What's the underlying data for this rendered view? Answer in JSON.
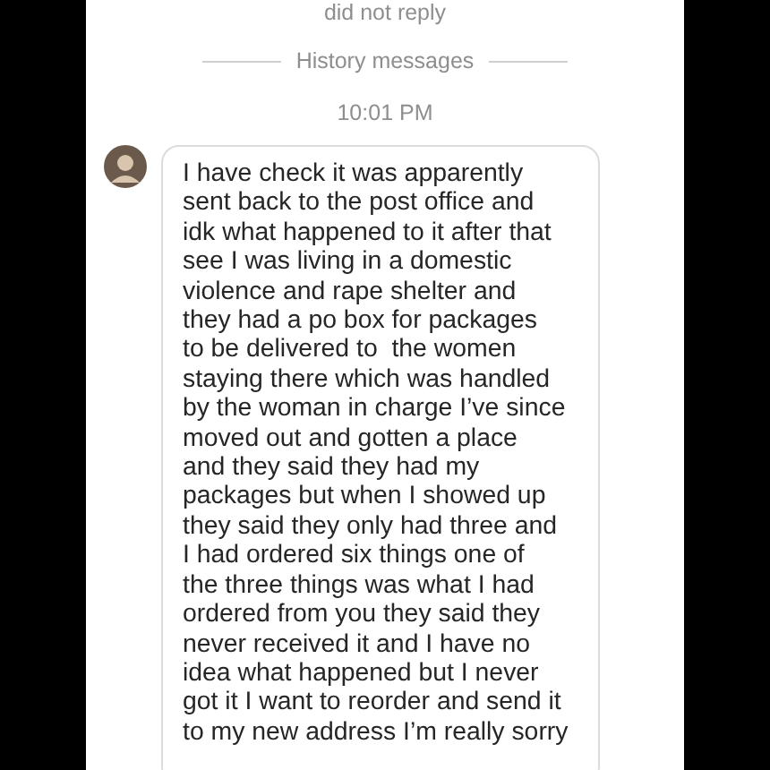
{
  "status_note": "did not reply",
  "divider_label": "History messages",
  "timestamp": "10:01 PM",
  "messages": [
    {
      "kind": "incoming",
      "text": "I have check it was apparently\nsent back to the post office and\nidk what happened to it after that\nsee I was living in a domestic\nviolence and rape shelter and\nthey had a po box for packages\nto be delivered to  the women\nstaying there which was handled\nby the woman in charge I’ve since\nmoved out and gotten a place\nand they said they had my\npackages but when I showed up\nthey said they only had three and\nI had ordered six things one of\nthe three things was what I had\nordered from you they said they\nnever received it and I have no\nidea what happened but I never\ngot it I want to reorder and send it\nto my new address I’m really sorry"
    }
  ]
}
